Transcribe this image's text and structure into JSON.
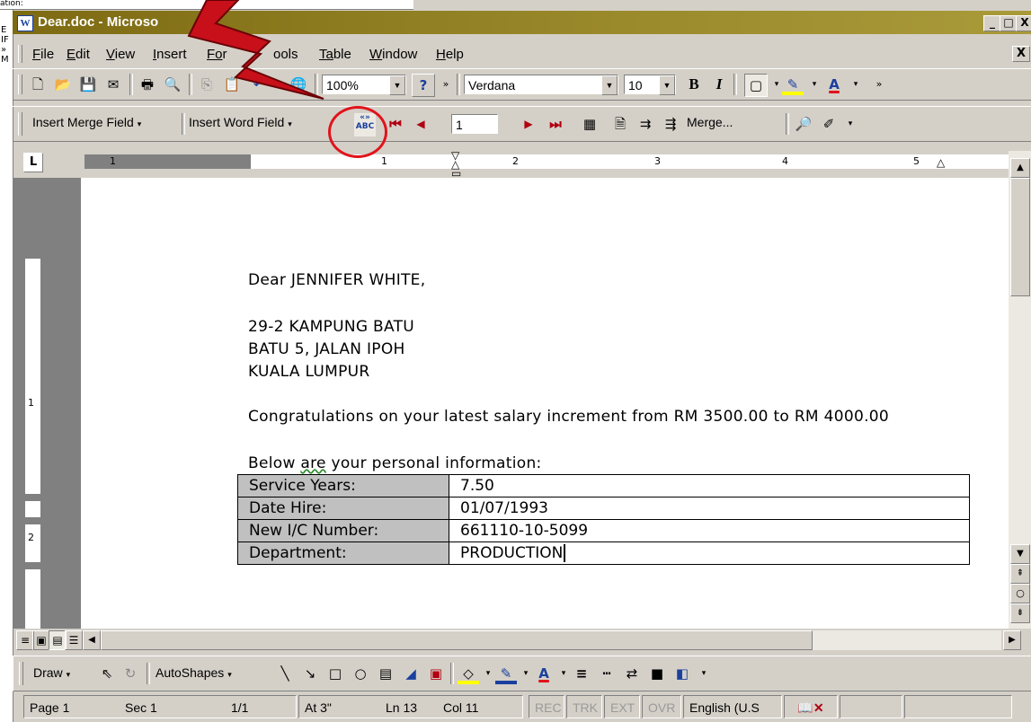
{
  "background_window": {
    "top_text": "ation:",
    "side_letters": [
      "E",
      "IF",
      "»",
      "M"
    ]
  },
  "titlebar": {
    "title": "Dear.doc - Microso",
    "app_icon": "W",
    "buttons": [
      "_",
      "□",
      "X"
    ]
  },
  "menubar": {
    "items": [
      {
        "key": "F",
        "rest": "ile"
      },
      {
        "key": "E",
        "rest": "dit"
      },
      {
        "key": "V",
        "rest": "iew"
      },
      {
        "key": "I",
        "rest": "nsert"
      },
      {
        "key": "Fo",
        "rest": "r"
      },
      {
        "key": "",
        "rest": "ools"
      },
      {
        "key": "Ta",
        "rest": "ble"
      },
      {
        "key": "W",
        "rest": "indow"
      },
      {
        "key": "H",
        "rest": "elp"
      }
    ],
    "close_doc": "X"
  },
  "standard_toolbar": {
    "zoom": "100%",
    "font": "Verdana",
    "size": "10",
    "bold": "B",
    "italic": "I",
    "font_color": "A"
  },
  "mailmerge_toolbar": {
    "insert_merge_field": "Insert Merge Field",
    "insert_word_field": "Insert Word Field",
    "view_merged_data": "«»\nABC",
    "record_number": "1",
    "merge_button": "Merge..."
  },
  "ruler": {
    "numbers": [
      "1",
      "1",
      "2",
      "3",
      "4",
      "5"
    ]
  },
  "vruler": {
    "numbers": [
      "1",
      "2"
    ]
  },
  "document": {
    "salutation": "Dear JENNIFER WHITE,",
    "address_line1": "29-2 KAMPUNG BATU",
    "address_line2": "BATU 5, JALAN IPOH",
    "address_line3": "KUALA LUMPUR",
    "congrats": "Congratulations on your latest salary increment from RM 3500.00 to RM 4000.00",
    "intro_before": "Below ",
    "intro_flagged": "are",
    "intro_after": " your personal information:",
    "table": [
      {
        "label": "Service Years:",
        "value": "7.50"
      },
      {
        "label": "Date Hire:",
        "value": "01/07/1993"
      },
      {
        "label": "New I/C Number:",
        "value": "661110-10-5099"
      },
      {
        "label": "Department:",
        "value": "PRODUCTION"
      }
    ]
  },
  "drawing_toolbar": {
    "draw": "Draw",
    "autoshapes": "AutoShapes"
  },
  "statusbar": {
    "page": "Page 1",
    "sec": "Sec 1",
    "pages": "1/1",
    "at": "At 3\"",
    "ln": "Ln 13",
    "col": "Col 11",
    "rec": "REC",
    "trk": "TRK",
    "ext": "EXT",
    "ovr": "OVR",
    "language": "English (U.S"
  },
  "colors": {
    "title_gradient_start": "#7d6a12",
    "annotation_red": "#e0141c",
    "bolt_red": "#c8101a",
    "face": "#d4d0c8"
  }
}
